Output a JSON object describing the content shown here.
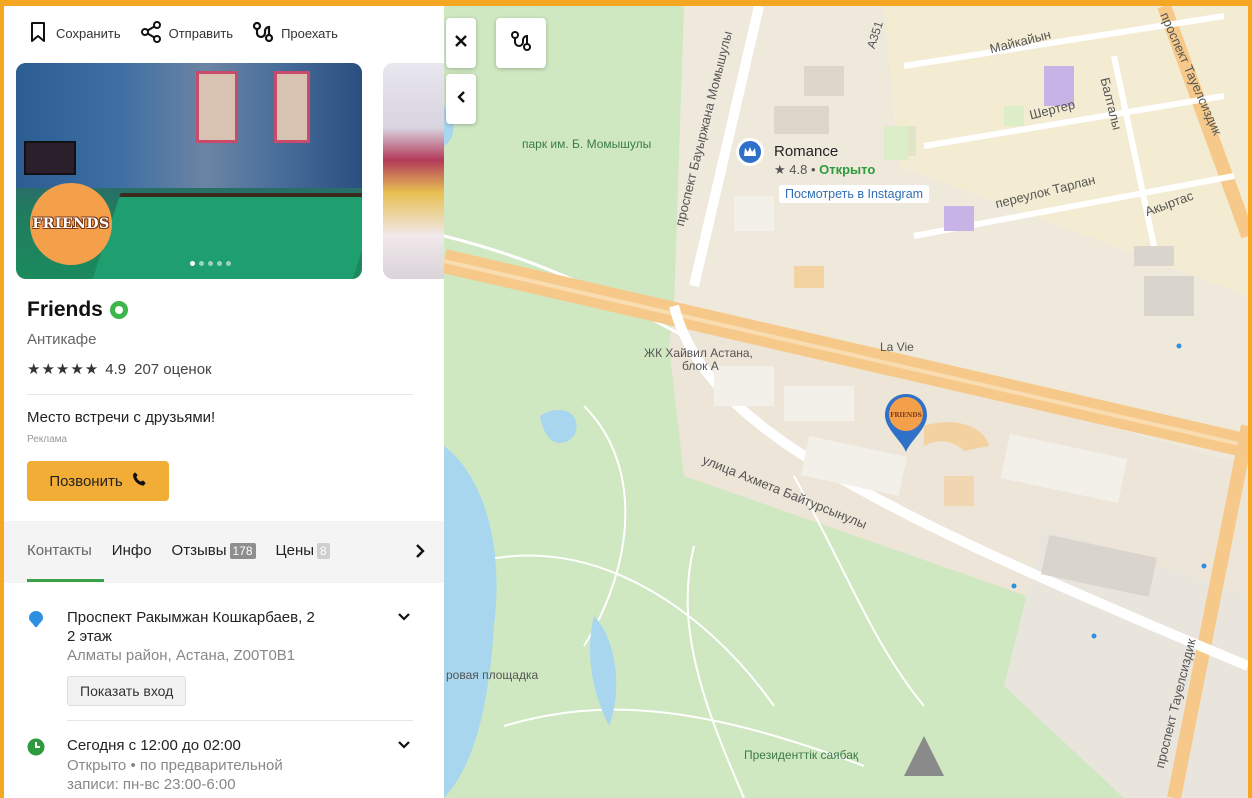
{
  "toolbar": {
    "save": "Сохранить",
    "share": "Отправить",
    "route": "Проехать"
  },
  "photo": {
    "logo_text": "FRIENDS",
    "dots": 5,
    "active_dot": 1
  },
  "place": {
    "name": "Friends",
    "category": "Антикафе",
    "stars": "★★★★★",
    "rating": "4.9",
    "reviews_count": "207 оценок",
    "ad_text": "Место встречи с друзьями!",
    "ad_label": "Реклама",
    "call_label": "Позвонить"
  },
  "tabs": [
    {
      "label": "Контакты",
      "badge": null,
      "active": true
    },
    {
      "label": "Инфо",
      "badge": null
    },
    {
      "label": "Отзывы",
      "badge": "178"
    },
    {
      "label": "Цены",
      "badge": "8"
    }
  ],
  "contacts": {
    "address_line1": "Проспект Ракымжан Кошкарбаев, 2",
    "address_line2": "2 этаж",
    "address_sub": "Алматы район, Астана, Z00T0B1",
    "entrance_label": "Показать вход",
    "hours_main": "Сегодня с 12:00 до 02:00",
    "hours_sub_1": "Открыто",
    "hours_sub_sep": " • ",
    "hours_sub_2": "по предварительной",
    "hours_sub_3": "записи: пн-вс 23:00-6:00"
  },
  "map": {
    "labels": {
      "park": "парк им. Б. Момышулы",
      "momyshuly_ave": "проспект Бауыржана Момышулы",
      "a351": "А351",
      "maikain": "Майкайын",
      "shertep": "Шертер",
      "baltaly": "Балталы",
      "tarlan": "переулок Тарлан",
      "akyrtas": "Акыртас",
      "tauelsizdik_top": "проспект Тауелсиздик",
      "tauelsizdik_bottom": "проспект Тауелсиздик",
      "la_vie": "La Vie",
      "hyvil": "ЖК Хайвил Астана,",
      "hyvil2": "блок А",
      "baitursynuly": "улица Ахмета Байтурсынулы",
      "playground": "ровая площадка",
      "prezident": "Президенттік саябақ"
    },
    "poi": {
      "name": "Romance",
      "rating": "★ 4.8",
      "status": "Открыто",
      "insta": "Посмотреть в Instagram"
    },
    "pin_text": "FRIENDS",
    "colors": {
      "park_green": "#cfe8c1",
      "road_orange": "#f6c98a",
      "water": "#a8d6ef",
      "block_beige": "#f1e9d6",
      "brand_orange": "#f1ad35"
    }
  }
}
